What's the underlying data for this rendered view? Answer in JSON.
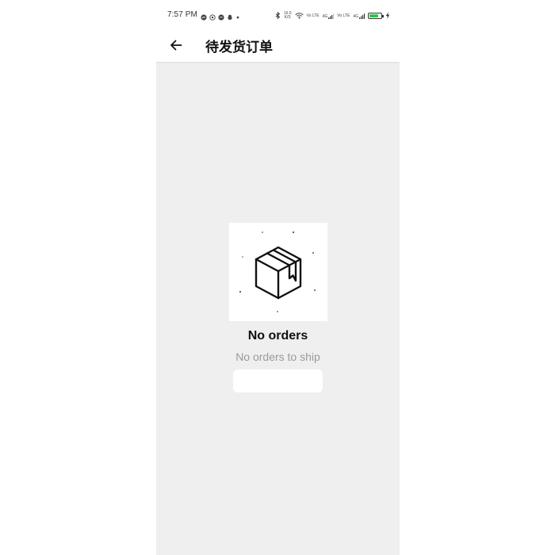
{
  "status_bar": {
    "time": "7:57 PM",
    "notification_icons": [
      "messenger-icon",
      "whatsapp-icon",
      "chat-icon",
      "snapchat-icon",
      "dot-icon"
    ],
    "speed_value": "16.0",
    "speed_unit": "K/S",
    "sim1_network": "Vo LTE",
    "sim1_gen": "4G",
    "sim2_network": "Vo LTE",
    "sim2_gen": "4G",
    "battery_level": 0.75,
    "battery_color": "#30c24a"
  },
  "header": {
    "back_icon": "arrow-left-icon",
    "title": "待发货订单"
  },
  "empty_state": {
    "illustration_icon": "package-box-icon",
    "title": "No orders",
    "subtitle": "No orders to ship",
    "action_label": ""
  },
  "colors": {
    "background": "#efefef",
    "surface": "#ffffff",
    "subtitle": "#9a9a9a"
  }
}
